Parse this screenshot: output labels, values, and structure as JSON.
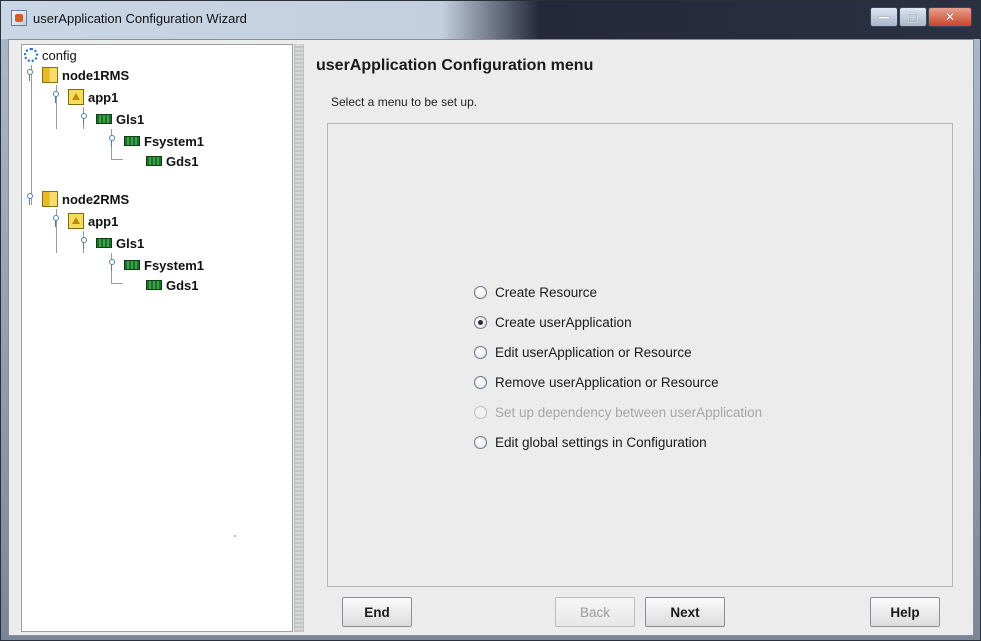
{
  "window": {
    "title": "userApplication Configuration Wizard",
    "buttons": [
      "minimize",
      "maximize",
      "close"
    ]
  },
  "tree": {
    "root": "config",
    "nodes": [
      {
        "label": "node1RMS",
        "icon": "node-icon"
      },
      {
        "label": "app1",
        "icon": "app-icon"
      },
      {
        "label": "Gls1",
        "icon": "resource-icon"
      },
      {
        "label": "Fsystem1",
        "icon": "resource-icon"
      },
      {
        "label": "Gds1",
        "icon": "resource-icon"
      },
      {
        "label": "node2RMS",
        "icon": "node-icon"
      },
      {
        "label": "app1",
        "icon": "app-icon"
      },
      {
        "label": "Gls1",
        "icon": "resource-icon"
      },
      {
        "label": "Fsystem1",
        "icon": "resource-icon"
      },
      {
        "label": "Gds1",
        "icon": "resource-icon"
      }
    ]
  },
  "main": {
    "title": "userApplication Configuration menu",
    "subtitle": "Select a menu to be set up.",
    "options": [
      {
        "label": "Create Resource",
        "selected": false,
        "enabled": true
      },
      {
        "label": "Create userApplication",
        "selected": true,
        "enabled": true
      },
      {
        "label": "Edit userApplication or Resource",
        "selected": false,
        "enabled": true
      },
      {
        "label": "Remove userApplication or Resource",
        "selected": false,
        "enabled": true
      },
      {
        "label": "Set up dependency between userApplication",
        "selected": false,
        "enabled": false
      },
      {
        "label": "Edit global settings in Configuration",
        "selected": false,
        "enabled": true
      }
    ]
  },
  "footer": {
    "end_label": "End",
    "back_label": "Back",
    "next_label": "Next",
    "help_label": "Help"
  }
}
